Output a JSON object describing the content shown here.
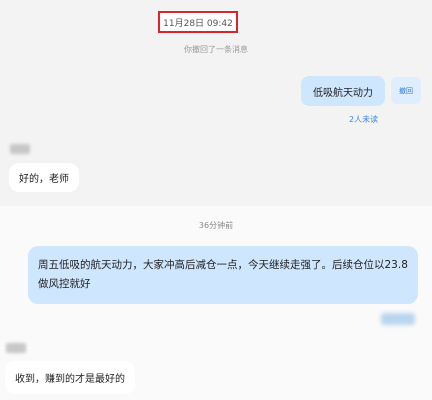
{
  "top_timestamp": "11月28日 09:42",
  "system_notice": "你撤回了一条消息",
  "message_right_1": {
    "text": "低吸航天动力",
    "action_label": "撤回",
    "read_status": "2人未读"
  },
  "message_left_1": {
    "text": "好的，老师"
  },
  "separator_time": "36分钟前",
  "message_right_2": {
    "text": "周五低吸的航天动力，大家冲高后减仓一点，今天继续走强了。后续仓位以23.8做风控就好"
  },
  "message_left_2": {
    "text": "收到，赚到的才是最好的"
  }
}
